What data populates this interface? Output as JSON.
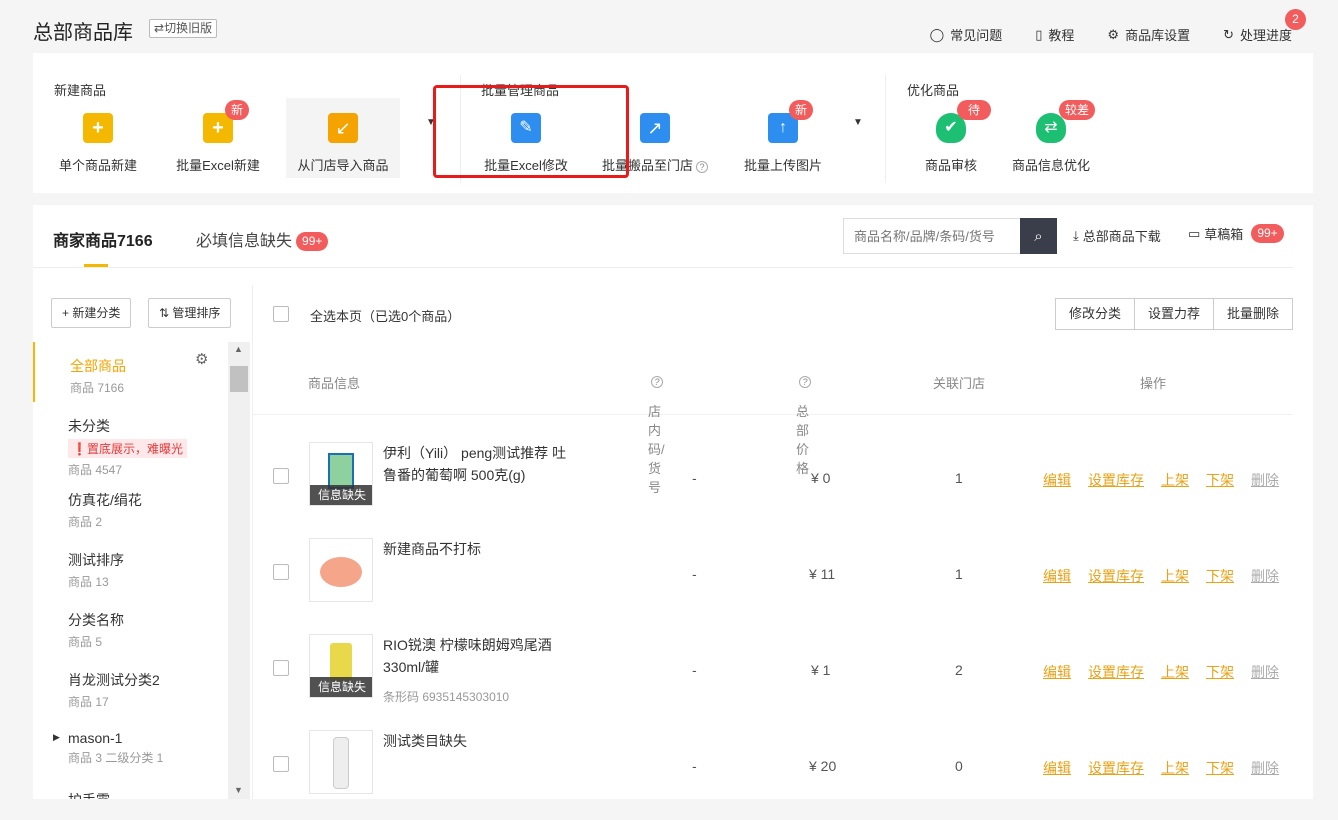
{
  "header": {
    "title": "总部商品库",
    "switch_label": "切换旧版",
    "links": [
      {
        "label": "常见问题",
        "icon": "chat-bubble-icon"
      },
      {
        "label": "教程",
        "icon": "document-icon"
      },
      {
        "label": "商品库设置",
        "icon": "gear-icon"
      },
      {
        "label": "处理进度",
        "icon": "refresh-icon",
        "badge": "2"
      }
    ]
  },
  "toolbar": {
    "groups": [
      {
        "title": "新建商品"
      },
      {
        "title": "批量管理商品"
      },
      {
        "title": "优化商品"
      }
    ],
    "tools": [
      {
        "label": "单个商品新建",
        "icon": "bag-plus-icon",
        "color": "#f5b800"
      },
      {
        "label": "批量Excel新建",
        "icon": "excel-plus-icon",
        "color": "#f5b800",
        "badge": "新"
      },
      {
        "label": "从门店导入商品",
        "icon": "box-import-icon",
        "color": "#f5a300"
      },
      {
        "label": "批量Excel修改",
        "icon": "excel-edit-icon",
        "color": "#2e8ef0"
      },
      {
        "label": "批量搬品至门店",
        "icon": "store-move-icon",
        "color": "#2e8ef0"
      },
      {
        "label": "批量上传图片",
        "icon": "image-upload-icon",
        "color": "#2e8ef0",
        "badge": "新"
      },
      {
        "label": "商品审核",
        "icon": "shield-check-icon",
        "color": "#1dbf73",
        "badge": "待修正"
      },
      {
        "label": "商品信息优化",
        "icon": "shield-refresh-icon",
        "color": "#1dbf73",
        "badge": "较差"
      }
    ]
  },
  "tabs": {
    "products_label": "商家商品7166",
    "missing_label": "必填信息缺失",
    "missing_badge": "99+"
  },
  "search": {
    "placeholder": "商品名称/品牌/条码/货号"
  },
  "download_label": "总部商品下载",
  "draft_label": "草稿箱",
  "draft_badge": "99+",
  "sidebar": {
    "new_category": "新建分类",
    "manage_sort": "管理排序",
    "categories": [
      {
        "name": "全部商品",
        "count": "商品 7166"
      },
      {
        "name": "未分类",
        "warning": "置底展示，难曝光",
        "count": "商品 4547"
      },
      {
        "name": "仿真花/绢花",
        "count": "商品 2"
      },
      {
        "name": "测试排序",
        "count": "商品 13"
      },
      {
        "name": "分类名称",
        "count": "商品 5"
      },
      {
        "name": "肖龙测试分类2",
        "count": "商品 17"
      },
      {
        "name": "mason-1",
        "count": "商品 3 二级分类 1"
      },
      {
        "name": "护手霜",
        "count": ""
      }
    ]
  },
  "list": {
    "select_all": "全选本页（已选0个商品）",
    "actions": [
      "修改分类",
      "设置力荐",
      "批量删除"
    ],
    "headers": {
      "info": "商品信息",
      "code": "店内码/货号",
      "price": "总部价格",
      "stores": "关联门店",
      "ops": "操作"
    },
    "op_labels": [
      "编辑",
      "设置库存",
      "上架",
      "下架",
      "删除"
    ],
    "missing_label": "信息缺失",
    "rows": [
      {
        "name": "伊利（Yili） peng测试推荐 吐鲁番的葡萄啊 500克(g)",
        "code": "-",
        "price": "¥ 0",
        "stores": "1",
        "missing": true,
        "barcode": ""
      },
      {
        "name": "新建商品不打标",
        "code": "-",
        "price": "¥ 11",
        "stores": "1",
        "missing": false,
        "barcode": ""
      },
      {
        "name": "RIO锐澳 柠檬味朗姆鸡尾酒 330ml/罐",
        "code": "-",
        "price": "¥ 1",
        "stores": "2",
        "missing": true,
        "barcode": "条形码 6935145303010"
      },
      {
        "name": "测试类目缺失",
        "code": "-",
        "price": "¥ 20",
        "stores": "0",
        "missing": false,
        "barcode": ""
      }
    ]
  }
}
